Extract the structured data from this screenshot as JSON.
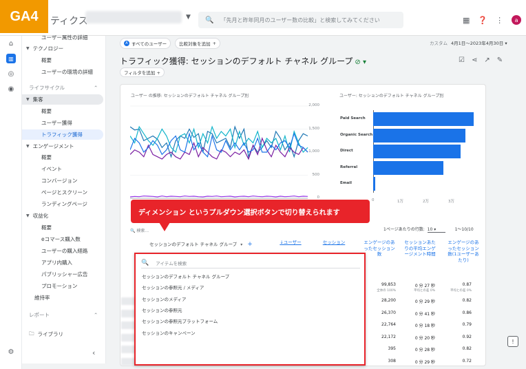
{
  "badge": "GA4",
  "app": {
    "title": "ティクス"
  },
  "search": {
    "placeholder": "「先月と昨年同月のユーザー数の比較」と検索してみてください"
  },
  "topbar": {
    "avatar": "a"
  },
  "sidebar": {
    "items": [
      {
        "label": "ユーザー属性の詳細",
        "kind": "item"
      },
      {
        "label": "テクノロジー",
        "kind": "sub"
      },
      {
        "label": "概要",
        "kind": "item"
      },
      {
        "label": "ユーザーの環境の詳細",
        "kind": "item"
      },
      {
        "label": "ライフサイクル",
        "kind": "sec"
      },
      {
        "label": "集客",
        "kind": "grp"
      },
      {
        "label": "概要",
        "kind": "item"
      },
      {
        "label": "ユーザー獲得",
        "kind": "item"
      },
      {
        "label": "トラフィック獲得",
        "kind": "active"
      },
      {
        "label": "エンゲージメント",
        "kind": "sub"
      },
      {
        "label": "概要",
        "kind": "item"
      },
      {
        "label": "イベント",
        "kind": "item"
      },
      {
        "label": "コンバージョン",
        "kind": "item"
      },
      {
        "label": "ページとスクリーン",
        "kind": "item"
      },
      {
        "label": "ランディングページ",
        "kind": "item"
      },
      {
        "label": "収益化",
        "kind": "sub"
      },
      {
        "label": "概要",
        "kind": "item"
      },
      {
        "label": "eコマース購入数",
        "kind": "item"
      },
      {
        "label": "ユーザーの購入経路",
        "kind": "item"
      },
      {
        "label": "アプリ内購入",
        "kind": "item"
      },
      {
        "label": "パブリッシャー広告",
        "kind": "item"
      },
      {
        "label": "プロモーション",
        "kind": "item"
      },
      {
        "label": "維持率",
        "kind": "plain"
      },
      {
        "label": "レポート",
        "kind": "sec"
      },
      {
        "label": "ライブラリ",
        "kind": "lib"
      }
    ]
  },
  "chips": {
    "all_users": "すべてのユーザー",
    "add_compare": "比較対象を追加"
  },
  "date": {
    "label": "カスタム",
    "range": "4月1日～2023年4月30日"
  },
  "page": {
    "title": "トラフィック獲得: セッションのデフォルト チャネル グループ",
    "add_filter": "フィルタを追加"
  },
  "chart_line": {
    "title": "ユーザー の推移: セッションのデフォルト チャネル グループ別",
    "yticks": [
      "2,000",
      "1,500",
      "1,000",
      "500",
      "0"
    ]
  },
  "chart_data": [
    {
      "type": "line",
      "title": "ユーザー の推移: セッションのデフォルト チャネル グループ別",
      "ylim": [
        0,
        2000
      ],
      "yticks": [
        0,
        500,
        1000,
        1500,
        2000
      ],
      "series": [
        {
          "color": "#1f77b4",
          "values": [
            1550,
            1480,
            1500,
            1250,
            1300,
            1350,
            1280,
            1100,
            1200,
            900,
            1250,
            1350,
            1300,
            1500,
            1320,
            1400,
            1000,
            1450,
            1400,
            1200,
            1250,
            1300,
            1100,
            1550,
            1300,
            1500,
            900,
            1150,
            1000,
            1100,
            1250,
            1100,
            1450,
            1300,
            1050,
            1200,
            900,
            1250,
            1400,
            1350
          ]
        },
        {
          "color": "#12b5cb",
          "values": [
            1350,
            1200,
            1550,
            1400,
            1250,
            1150,
            1300,
            1500,
            1350,
            1100,
            1000,
            1350,
            1400,
            1200,
            1500,
            1100,
            1400,
            1200,
            1550,
            1300,
            1450,
            1350,
            1500,
            1100,
            1450,
            1150,
            1300,
            1200,
            1450,
            1100,
            1300,
            1200,
            1300,
            1050,
            1350,
            1000,
            1450,
            1200,
            1000,
            1100
          ]
        },
        {
          "color": "#7b1fa2",
          "values": [
            950,
            1050,
            1000,
            900,
            1150,
            950,
            900,
            850,
            950,
            1000,
            900,
            850,
            1000,
            950,
            1200,
            900,
            1100,
            1000,
            900,
            850,
            1050,
            1000,
            900,
            1000,
            950,
            1050,
            850,
            1150,
            950,
            1300,
            1050,
            900,
            1150,
            1000,
            900,
            1100,
            1000,
            950,
            1100,
            1000
          ]
        },
        {
          "color": "#1a73e8",
          "values": [
            1050,
            1300,
            1200,
            1000,
            1100,
            1250,
            1150,
            950,
            1050,
            1250,
            1350,
            1050,
            1000,
            1400,
            1050,
            1200,
            1000,
            900,
            1350,
            1050,
            1000,
            1250,
            1050,
            1200,
            1050,
            1200,
            1000,
            1050,
            1300,
            1000,
            1000,
            1150,
            1050,
            1200,
            1250,
            1100,
            1400,
            1150,
            1100,
            1000
          ]
        },
        {
          "color": "#9334e6",
          "values": [
            30,
            40,
            35,
            50,
            45,
            40,
            30,
            50,
            35,
            45,
            40,
            35,
            50,
            40,
            45,
            35,
            30,
            45,
            40,
            50,
            35,
            40,
            45,
            30,
            40,
            45,
            35,
            50,
            40,
            35,
            45,
            40,
            30,
            45,
            35,
            40,
            50,
            35,
            45,
            40
          ]
        }
      ]
    },
    {
      "type": "bar",
      "title": "ユーザー: セッションのデフォルト チャネル グループ別",
      "categories": [
        "Paid Search",
        "Organic Search",
        "Direct",
        "Referral",
        "Email"
      ],
      "values": [
        3850,
        3550,
        3350,
        2700,
        80
      ],
      "xticks": [
        "0",
        "1万",
        "2万",
        "3万"
      ],
      "xtick_values": [
        0,
        1000,
        2000,
        3000
      ],
      "xlim": [
        0,
        3000
      ]
    }
  ],
  "annotation": "ディメンション というプルダウン選択ボタンで切り替えられます",
  "table": {
    "search_placeholder": "検索...",
    "rows_per_page_label": "1ページあたりの行数:",
    "rows_per_page": "10",
    "pagination": "1～10/10",
    "dimension": "セッションのデフォルト チャネル グループ",
    "headers": [
      "↓ユーザー",
      "セッション",
      "エンゲージのあったセッション数",
      "セッションあたりの平均エンゲージメント時間",
      "エンゲージのあったセッション数(1ユーザーあたり)"
    ],
    "totals": {
      "users": "99,853",
      "users_sub": "全体の 100%",
      "time": "0 分 27 秒",
      "time_sub": "平均との差 0%",
      "eng": "0.87",
      "eng_sub": "平均との差 0%"
    },
    "rows": [
      {
        "users": "28,200",
        "time": "0 分 29 秒",
        "eng": "0.82"
      },
      {
        "users": "26,370",
        "time": "0 分 41 秒",
        "eng": "0.86"
      },
      {
        "users": "22,764",
        "time": "0 分 18 秒",
        "eng": "0.79"
      },
      {
        "users": "22,172",
        "time": "0 分 20 秒",
        "eng": "0.92"
      },
      {
        "users": "395",
        "time": "0 分 28 秒",
        "eng": "0.82"
      },
      {
        "users": "308",
        "time": "0 分 29 秒",
        "eng": "0.72"
      }
    ]
  },
  "dropdown": {
    "search_placeholder": "アイテムを検索",
    "items": [
      "セッションのデフォルト チャネル グループ",
      "セッションの参照元 / メディア",
      "セッションのメディア",
      "セッションの参照元",
      "セッションの参照元プラットフォーム",
      "セッションのキャンペーン"
    ]
  }
}
